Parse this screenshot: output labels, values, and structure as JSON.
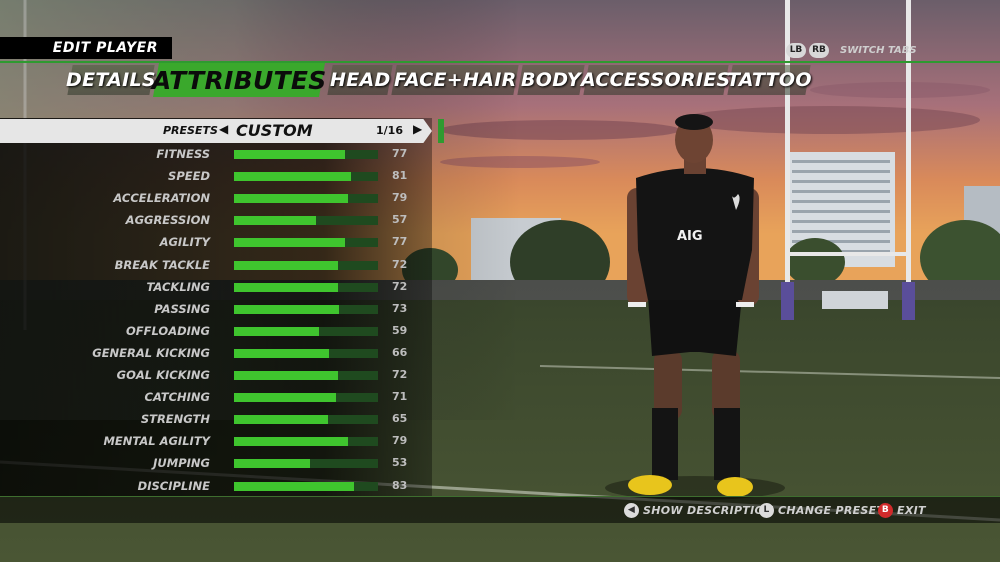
{
  "header": {
    "title": "EDIT PLAYER"
  },
  "tabs": [
    {
      "label": "DETAILS",
      "active": false
    },
    {
      "label": "ATTRIBUTES",
      "active": true
    },
    {
      "label": "HEAD",
      "active": false
    },
    {
      "label": "FACE+HAIR",
      "active": false
    },
    {
      "label": "BODY",
      "active": false
    },
    {
      "label": "ACCESSORIES",
      "active": false
    },
    {
      "label": "TATTOO",
      "active": false
    }
  ],
  "switch_tabs": {
    "lb": "LB",
    "rb": "RB",
    "label": "SWITCH TABS"
  },
  "presets": {
    "label": "PRESETS",
    "value": "CUSTOM",
    "count": "1/16",
    "prev_glyph": "◀",
    "next_glyph": "▶"
  },
  "attributes": [
    {
      "name": "FITNESS",
      "value": 77
    },
    {
      "name": "SPEED",
      "value": 81
    },
    {
      "name": "ACCELERATION",
      "value": 79
    },
    {
      "name": "AGGRESSION",
      "value": 57
    },
    {
      "name": "AGILITY",
      "value": 77
    },
    {
      "name": "BREAK TACKLE",
      "value": 72
    },
    {
      "name": "TACKLING",
      "value": 72
    },
    {
      "name": "PASSING",
      "value": 73
    },
    {
      "name": "OFFLOADING",
      "value": 59
    },
    {
      "name": "GENERAL KICKING",
      "value": 66
    },
    {
      "name": "GOAL KICKING",
      "value": 72
    },
    {
      "name": "CATCHING",
      "value": 71
    },
    {
      "name": "STRENGTH",
      "value": 65
    },
    {
      "name": "MENTAL AGILITY",
      "value": 79
    },
    {
      "name": "JUMPING",
      "value": 53
    },
    {
      "name": "DISCIPLINE",
      "value": 83
    }
  ],
  "attribute_max": 100,
  "jersey": {
    "sponsor": "AIG"
  },
  "help": {
    "show_description": {
      "icon": "left-stick-icon",
      "glyph": "◀",
      "label": "SHOW DESCRIPTION"
    },
    "change_presets": {
      "icon": "l-stick-icon",
      "glyph": "L",
      "label": "CHANGE PRESETS"
    },
    "exit": {
      "icon": "b-button-icon",
      "glyph": "B",
      "label": "EXIT"
    }
  },
  "colors": {
    "accent_green": "#3fc52e",
    "tab_green": "#3aa82c",
    "b_button": "#d12a2a"
  }
}
